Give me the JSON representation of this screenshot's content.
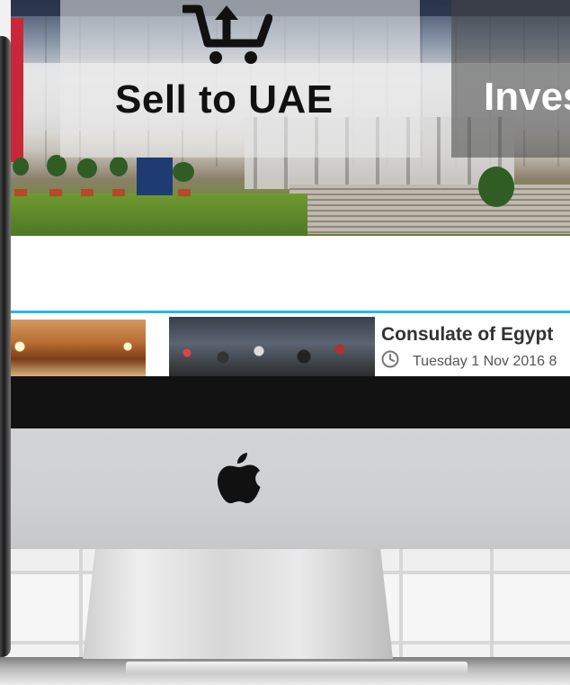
{
  "hero": {
    "sell_label": "Sell to UAE",
    "invest_label": "Inves",
    "cart_icon": "cart-upload-icon"
  },
  "news": {
    "title": "Consulate of Egypt",
    "date": "Tuesday 1 Nov 2016 8",
    "date_icon": "clock-icon"
  },
  "monitor": {
    "logo": "apple-logo-icon"
  },
  "colors": {
    "accent": "#29b6e6",
    "bezel": "#121212",
    "chin": "#d0d1d3"
  }
}
